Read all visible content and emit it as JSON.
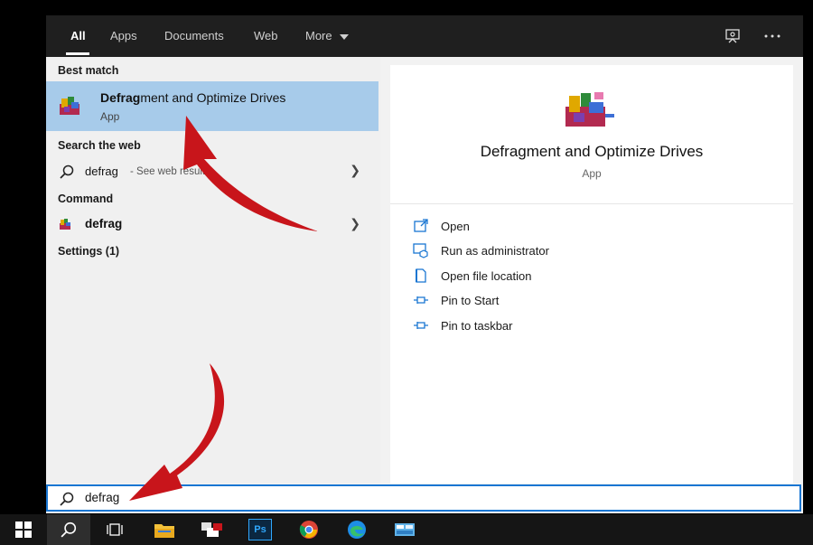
{
  "tabs": [
    {
      "label": "All",
      "active": true
    },
    {
      "label": "Apps"
    },
    {
      "label": "Documents"
    },
    {
      "label": "Web"
    },
    {
      "label": "More"
    }
  ],
  "sections": {
    "best_match": "Best match",
    "search_web": "Search the web",
    "command": "Command",
    "settings": "Settings (1)"
  },
  "best_match": {
    "title_bold": "Defrag",
    "title_rest": "ment and Optimize Drives",
    "subtitle": "App"
  },
  "web_result": {
    "query": "defrag",
    "suffix": " - See web results"
  },
  "command_result": {
    "label": "defrag"
  },
  "detail": {
    "title": "Defragment and Optimize Drives",
    "subtitle": "App",
    "actions": [
      {
        "label": "Open",
        "icon": "open-icon"
      },
      {
        "label": "Run as administrator",
        "icon": "run-as-admin-icon"
      },
      {
        "label": "Open file location",
        "icon": "file-location-icon"
      },
      {
        "label": "Pin to Start",
        "icon": "pin-icon"
      },
      {
        "label": "Pin to taskbar",
        "icon": "pin-icon"
      }
    ]
  },
  "search": {
    "value": "defrag"
  },
  "taskbar": {
    "photoshop_label": "Ps"
  },
  "colors": {
    "accent": "#1976d2",
    "selection": "#a7cbea",
    "arrow": "#c8151b"
  }
}
